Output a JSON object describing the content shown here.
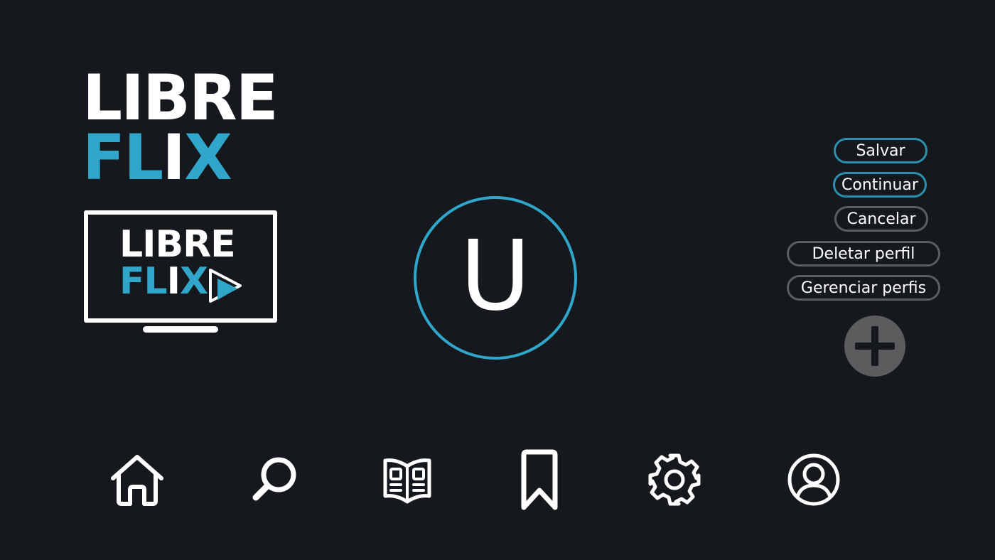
{
  "brand": {
    "name_line1": "LIBRE",
    "name_line2_a": "FL",
    "name_line2_b": "I",
    "name_line2_c": "X",
    "accent_color": "#2fa6ca"
  },
  "profile": {
    "initial": "U",
    "ring_color": "#2fa6ca"
  },
  "actions": {
    "save_label": "Salvar",
    "continue_label": "Continuar",
    "cancel_label": "Cancelar",
    "delete_label": "Deletar perfil",
    "manage_label": "Gerenciar perfis",
    "add_icon": "plus-icon"
  },
  "bottom_nav": [
    {
      "icon": "home-icon"
    },
    {
      "icon": "search-icon"
    },
    {
      "icon": "news-icon"
    },
    {
      "icon": "bookmark-icon"
    },
    {
      "icon": "settings-icon"
    },
    {
      "icon": "profile-icon"
    }
  ]
}
